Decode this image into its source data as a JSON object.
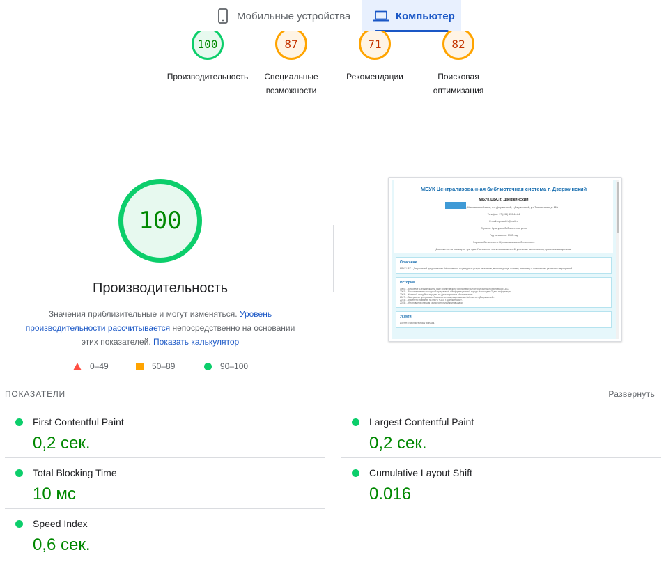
{
  "tabs": {
    "mobile": {
      "label": "Мобильные устройства",
      "icon": "smartphone-icon"
    },
    "desktop": {
      "label": "Компьютер",
      "icon": "laptop-icon",
      "active": true
    }
  },
  "categories": [
    {
      "score": "100",
      "label_line1": "Производительность",
      "label_line2": "",
      "rating": "good"
    },
    {
      "score": "87",
      "label_line1": "Специальные",
      "label_line2": "возможности",
      "rating": "average"
    },
    {
      "score": "71",
      "label_line1": "Рекомендации",
      "label_line2": "",
      "rating": "average"
    },
    {
      "score": "82",
      "label_line1": "Поисковая",
      "label_line2": "оптимизация",
      "rating": "average"
    }
  ],
  "performance": {
    "score": "100",
    "title": "Производительность",
    "desc_part1": "Значения приблизительные и могут изменяться. ",
    "desc_link1": "Уровень производительности рассчитывается",
    "desc_part2": " непосредственно на основании этих показателей. ",
    "desc_link2": "Показать калькулятор"
  },
  "legend": {
    "fail": "0–49",
    "average": "50–89",
    "pass": "90–100"
  },
  "thumbnail": {
    "site_title": "МБУК Централизованная библиотечная система г. Дзержинский",
    "site_sub": "МБУК ЦБС г. Дзержинский",
    "lines": [
      "Адрес: 140090, Московская область, г. о. Дзержинский, г. Дзержинский, ул. Томилинская, д. 22А",
      "Телефон: +7 (495) 550-44-84",
      "E-mail: cgmardzh@mail.ru",
      "Отрасль: Культура и библиотечное дело",
      "Год основания: 1983 год",
      "Форма собственности: Муниципальная собственность",
      "Достижения за последние три года: Увеличение числа пользователей, успешные мероприятия, проекты и инициативы."
    ],
    "card1_title": "Описание",
    "card1_text": "МБУК ЦБС г. Дзержинский предоставляет библиотечные и культурные услуги населению, включая доступ к книгам, интернету и организацию различных мероприятий.",
    "card2_title": "История",
    "card2_lines": [
      "1960г. - В поселке Дзержинский на базе Гранитовского библиотеки был открыт филиал Люберецкой ЦБС.",
      "2002г. - В соответствии с городской программой «Информационный город» был создан Отдел информации.",
      "2003г. - Книжный фонд был передан на Дистанционное обслуживание.",
      "2007г. - Завершены программы «Развитие сети муниципальных библиотек г. Дзержинский».",
      "2014г. - Изменено название на МБУК «ЦБС г. Дзержинский».",
      "2015г. - Установлена станция самостоятельной книговыдачи."
    ],
    "card3_title": "Услуги",
    "card3_text": "Доступ к библиотечному фондам."
  },
  "metrics": {
    "section_label": "ПОКАЗАТЕЛИ",
    "expand_label": "Развернуть",
    "fcp": {
      "name": "First Contentful Paint",
      "value": "0,2 сек."
    },
    "lcp": {
      "name": "Largest Contentful Paint",
      "value": "0,2 сек."
    },
    "tbt": {
      "name": "Total Blocking Time",
      "value": "10 мс"
    },
    "cls": {
      "name": "Cumulative Layout Shift",
      "value": "0.016"
    },
    "si": {
      "name": "Speed Index",
      "value": "0,6 сек."
    }
  },
  "colors": {
    "pass": "#0cce6b",
    "average": "#ffa400",
    "fail": "#ff4e42",
    "link": "#1a57c6",
    "pass_text": "#008800",
    "average_text": "#c33300"
  }
}
